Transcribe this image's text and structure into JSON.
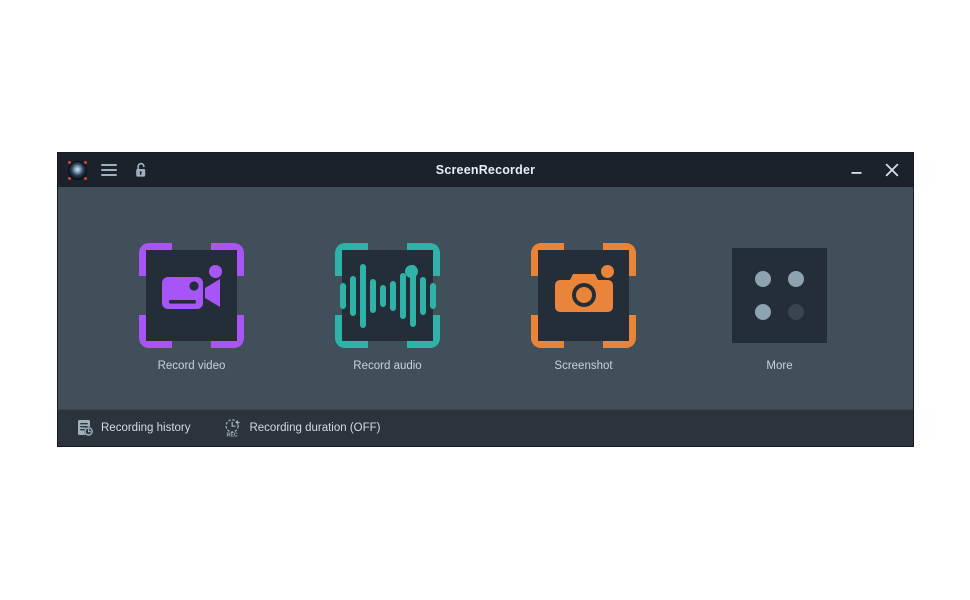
{
  "window": {
    "title": "ScreenRecorder",
    "titlebar": {
      "logo_icon": "msi-dragon-shield-icon",
      "menu_icon": "hamburger-menu-icon",
      "lock_icon": "unlocked-padlock-icon",
      "minimize_icon": "minimize-icon",
      "close_icon": "close-icon"
    },
    "colors": {
      "titlebar_bg": "#1b222b",
      "body_bg": "#414f5a",
      "bottombar_bg": "#2b343d",
      "tile_bg": "#242e38",
      "accent_video": "#a855f7",
      "accent_audio": "#2fb3a8",
      "accent_screenshot": "#e8853a",
      "accent_more": "#8ea3b2",
      "label_text": "#c6d2db"
    }
  },
  "tiles": [
    {
      "id": "record-video",
      "label": "Record video",
      "icon": "camcorder-icon",
      "accent": "#a855f7",
      "has_brackets": true,
      "has_rec_dot": true
    },
    {
      "id": "record-audio",
      "label": "Record audio",
      "icon": "audio-waveform-icon",
      "accent": "#2fb3a8",
      "has_brackets": true,
      "has_rec_dot": true,
      "waveform_bars": [
        26,
        40,
        64,
        34,
        22,
        30,
        46,
        62,
        38,
        26
      ]
    },
    {
      "id": "screenshot",
      "label": "Screenshot",
      "icon": "camera-icon",
      "accent": "#e8853a",
      "has_brackets": true,
      "has_rec_dot": true
    },
    {
      "id": "more",
      "label": "More",
      "icon": "four-dots-icon",
      "accent": "#8ea3b2",
      "has_brackets": false,
      "has_rec_dot": false
    }
  ],
  "bottom_bar": {
    "items": [
      {
        "id": "recording-history",
        "label": "Recording history",
        "icon": "document-clock-icon"
      },
      {
        "id": "recording-duration",
        "label": "Recording duration (OFF)",
        "icon": "clock-rec-icon",
        "state": "OFF"
      }
    ]
  }
}
